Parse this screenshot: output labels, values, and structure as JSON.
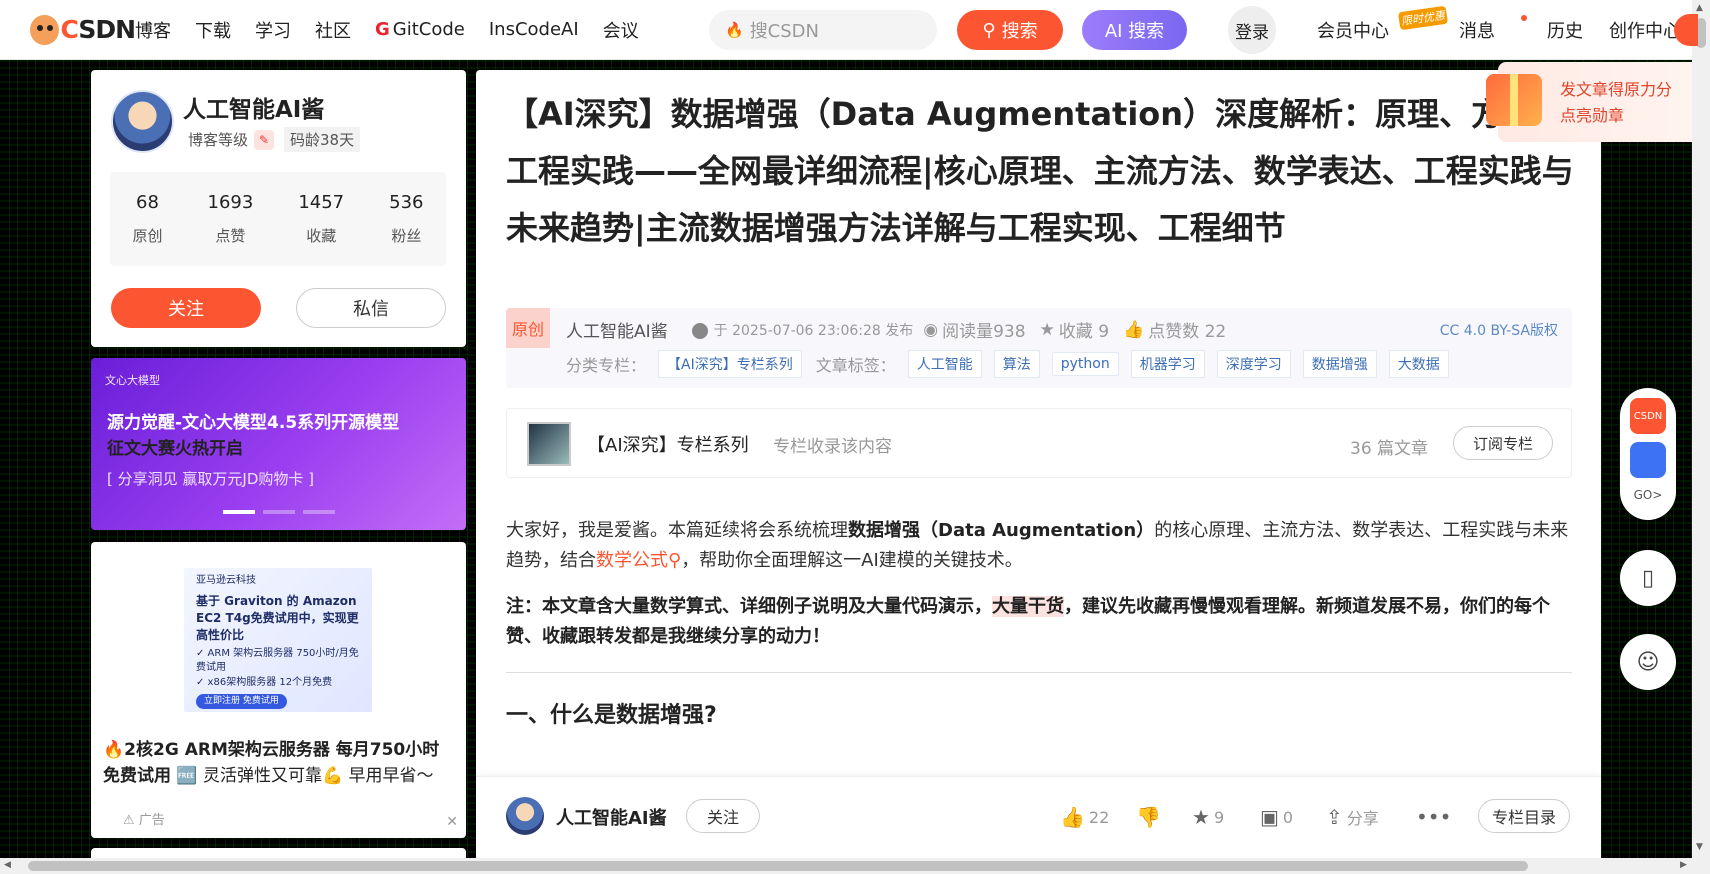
{
  "nav": {
    "items": [
      "博客",
      "下载",
      "学习",
      "社区"
    ],
    "gitcode": "GitCode",
    "inscode": "InsCodeAI",
    "meeting": "会议",
    "search_placeholder": "搜CSDN",
    "search_btn": "搜索",
    "ai_search_btn": "AI 搜索",
    "login": "登录",
    "vip": "会员中心",
    "vip_tag": "限时优惠",
    "messages": "消息",
    "history": "历史",
    "creator": "创作中心"
  },
  "profile": {
    "name": "人工智能AI酱",
    "level_label": "博客等级",
    "code_age": "码龄38天",
    "stats": [
      {
        "num": "68",
        "label": "原创"
      },
      {
        "num": "1693",
        "label": "点赞"
      },
      {
        "num": "1457",
        "label": "收藏"
      },
      {
        "num": "536",
        "label": "粉丝"
      }
    ],
    "follow": "关注",
    "message": "私信"
  },
  "banner": {
    "brand": "文心大模型",
    "line1": "源力觉醒-文心大模型4.5系列开源模型",
    "line2": "征文大赛火热开启",
    "line3": "[ 分享洞见  赢取万元JD购物卡 ]"
  },
  "ad": {
    "brand": "亚马逊云科技",
    "img_title": "基于 Graviton 的 Amazon EC2 T4g免费试用中，实现更高性价比",
    "img_line1": "✓ ARM 架构云服务器 750小时/月免费试用",
    "img_line2": "✓ x86架构服务器 12个月免费",
    "img_cta": "立即注册 免费试用",
    "text_bold": "🔥2核2G ARM架构云服务器 每月750小时免费试用",
    "text_rest": "🆓 灵活弹性又可靠💪 早用早省～",
    "tag": "广告"
  },
  "article": {
    "title": "【AI深究】数据增强（Data Augmentation）深度解析：原理、方法与工程实践——全网最详细流程|核心原理、主流方法、数学表达、工程实践与未来趋势|主流数据增强方法详解与工程实现、工程细节",
    "original": "原创",
    "author": "人工智能AI酱",
    "date": "于 2025-07-06 23:06:28 发布",
    "reads": "阅读量938",
    "favs": "收藏 9",
    "likes": "点赞数 22",
    "license": "CC 4.0 BY-SA版权",
    "category_label": "分类专栏：",
    "category": "【AI深究】专栏系列",
    "tags_label": "文章标签：",
    "tags": [
      "人工智能",
      "算法",
      "python",
      "机器学习",
      "深度学习",
      "数据增强",
      "大数据"
    ],
    "column_title": "【AI深究】专栏系列",
    "column_sub": "专栏收录该内容",
    "column_count": "36 篇文章",
    "column_btn": "订阅专栏",
    "p1_a": " 大家好，我是爱酱。本篇延续将会系统梳理",
    "p1_b": "数据增强（Data Augmentation）",
    "p1_c": "的核心原理、主流方法、数学表达、工程实践与未来趋势，结合",
    "p1_link": "数学公式",
    "p1_d": "，帮助你全面理解这一AI建模的关键技术。",
    "p2_a": "注：本文章含大量数学算式、详细例子说明及大量代码演示，",
    "p2_hl": "大量干货",
    "p2_b": "，建议先收藏再慢慢观看理解。新频道发展不易，你们的每个赞、收藏跟转发都是我继续分享的动力！",
    "h2": "一、什么是数据增强?"
  },
  "bottom": {
    "author": "人工智能AI酱",
    "follow": "关注",
    "likes": "22",
    "favs": "9",
    "comments": "0",
    "share": "分享",
    "toc": "专栏目录"
  },
  "rewards": {
    "line1": "发文章得原力分",
    "line2": "点亮勋章"
  },
  "side": {
    "csdn": "CSDN",
    "go": "GO>"
  }
}
